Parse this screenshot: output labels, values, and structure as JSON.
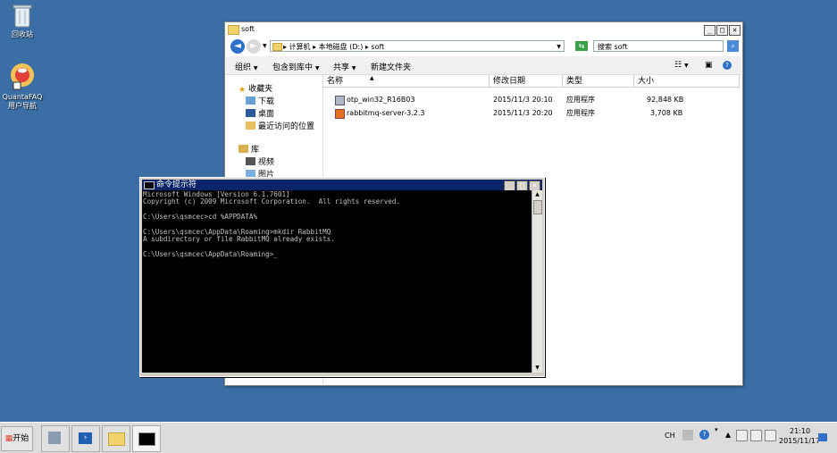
{
  "desktop": {
    "icons": [
      {
        "label": "回收站",
        "icon": "recycle-bin-icon"
      },
      {
        "label": "QuantaFAQ用户导航",
        "icon": "quantafaq-icon"
      }
    ]
  },
  "explorer": {
    "title": "soft",
    "address": {
      "parts": [
        "计算机",
        "本地磁盘 (D:)",
        "soft"
      ]
    },
    "search_placeholder": "搜索 soft",
    "toolbar": {
      "organize": "组织",
      "include_in_library": "包含到库中",
      "share": "共享",
      "new_folder": "新建文件夹"
    },
    "nav": {
      "favorites": "收藏夹",
      "downloads": "下载",
      "desktop": "桌面",
      "recent": "最近访问的位置",
      "libraries": "库",
      "videos": "视频",
      "pictures": "图片"
    },
    "columns": {
      "name": "名称",
      "modified": "修改日期",
      "type": "类型",
      "size": "大小"
    },
    "files": [
      {
        "name": "otp_win32_R16B03",
        "modified": "2015/11/3 20:10",
        "type": "应用程序",
        "size": "92,848 KB"
      },
      {
        "name": "rabbitmq-server-3.2.3",
        "modified": "2015/11/3 20:20",
        "type": "应用程序",
        "size": "3,708 KB"
      }
    ]
  },
  "cmd": {
    "title": "命令提示符",
    "lines": [
      "Microsoft Windows [Version 6.1.7601]",
      "Copyright (c) 2009 Microsoft Corporation.  All rights reserved.",
      "",
      "C:\\Users\\qsmcec>cd %APPDATA%",
      "",
      "C:\\Users\\qsmcec\\AppData\\Roaming>mkdir RabbitMQ",
      "A subdirectory or file RabbitMQ already exists.",
      "",
      "C:\\Users\\qsmcec\\AppData\\Roaming>_"
    ]
  },
  "taskbar": {
    "start": "开始",
    "lang": "CH",
    "time": "21:10",
    "date": "2015/11/17"
  }
}
